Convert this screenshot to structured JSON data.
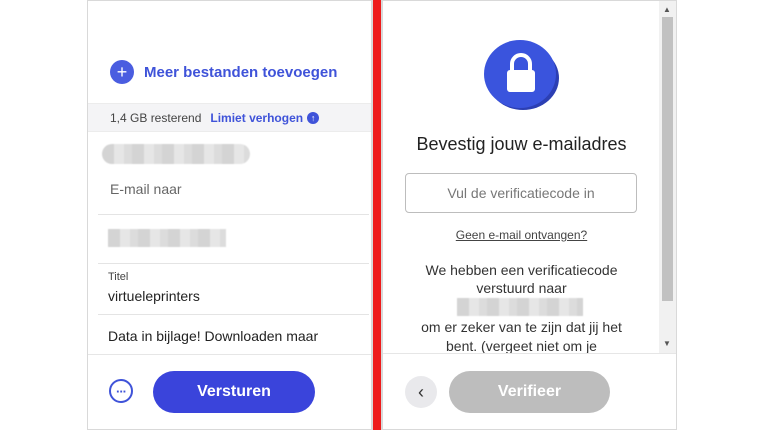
{
  "left_panel": {
    "add_files_label": "Meer bestanden toevoegen",
    "add_icon": "plus-icon",
    "storage_remaining": "1,4 GB resterend",
    "increase_limit_label": "Limiet verhogen",
    "email_to_placeholder": "E-mail naar",
    "title_label": "Titel",
    "title_value": "virtueleprinters",
    "message_text": "Data in bijlage! Downloaden maar",
    "more_icon": "more-horizontal-icon",
    "send_label": "Versturen"
  },
  "right_panel": {
    "lock_icon": "lock-icon",
    "heading": "Bevestig jouw e-mailadres",
    "code_placeholder": "Vul de verificatiecode in",
    "no_email_link": "Geen e-mail ontvangen?",
    "info_line1": "We hebben een verificatiecode",
    "info_line2": "verstuurd naar",
    "info_line3": "om er zeker van te zijn dat jij het",
    "info_line4": "bent. (vergeet niet om je",
    "back_icon": "chevron-left-icon",
    "verify_label": "Verifieer"
  },
  "colors": {
    "accent": "#3a44db",
    "divider": "#ee1c1c",
    "disabled": "#bdbdbd"
  }
}
